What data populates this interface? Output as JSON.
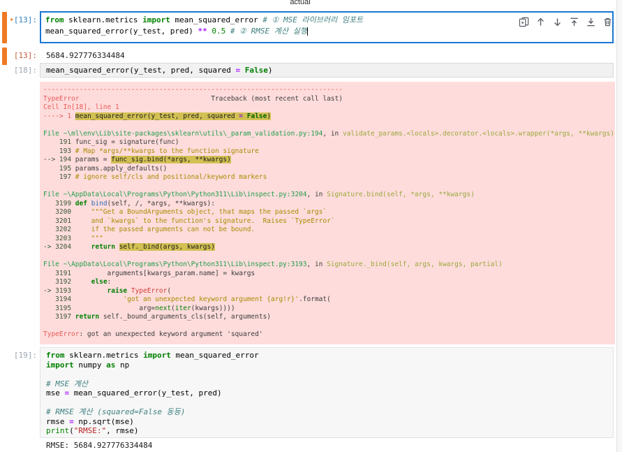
{
  "plot_above": {
    "xaxis_label_clipped": "actual"
  },
  "colors": {
    "active_cell_border": "#1976d2",
    "dirty_cell_bar": "#ee7a24",
    "error_background": "#ffdcdc",
    "error_highlight": "#d2c053",
    "input_prompt_active": "#307fc1",
    "input_prompt_idle": "#9aa5b1",
    "output_prompt": "#bf5b3d"
  },
  "cell_toolbar": {
    "icons": [
      "duplicate-cell-icon",
      "move-cell-up-icon",
      "move-cell-down-icon",
      "insert-cell-above-icon",
      "insert-cell-below-icon",
      "delete-cell-icon"
    ]
  },
  "cells": {
    "c13": {
      "bullet": "•",
      "prompt": "[13]:",
      "code": [
        [
          [
            "k",
            "from"
          ],
          [
            "p",
            " sklearn.metrics "
          ],
          [
            "k",
            "import"
          ],
          [
            "p",
            " mean_squared_error "
          ],
          [
            "c",
            "# ① MSE 라이브러리 임포트"
          ]
        ],
        [
          [
            "p",
            "mean_squared_error(y_test, pred) "
          ],
          [
            "o",
            "**"
          ],
          [
            "p",
            " "
          ],
          [
            "n",
            "0.5"
          ],
          [
            "p",
            " "
          ],
          [
            "c",
            "# ② RMSE 계산 실행"
          ],
          [
            "cur",
            ""
          ]
        ]
      ]
    },
    "o13": {
      "prompt": "[13]:",
      "value": "5684.927776334484"
    },
    "c18": {
      "prompt": "[18]:",
      "code": [
        [
          [
            "p",
            "mean_squared_error(y_test, pred, squared "
          ],
          [
            "o",
            "="
          ],
          [
            "p",
            " "
          ],
          [
            "k",
            "False"
          ],
          [
            "p",
            ")"
          ]
        ]
      ]
    },
    "traceback": {
      "lines": [
        [
          [
            "r",
            "---------------------------------------------------------------------------"
          ]
        ],
        [
          [
            "r",
            "TypeError"
          ],
          [
            "d",
            "                                 Traceback (most recent call last)"
          ]
        ],
        [
          [
            "r",
            "Cell In[18], line 1"
          ]
        ],
        [
          [
            "r",
            "----> 1"
          ],
          [
            "p",
            " "
          ],
          [
            "hl",
            "mean_squared_error(y_test, pred, squared "
          ],
          [
            "hlo",
            "="
          ],
          [
            "hl",
            " "
          ],
          [
            "hlk",
            "False"
          ],
          [
            "hl",
            ")"
          ]
        ],
        [],
        [
          [
            "g",
            "File ~\\ml\\env\\Lib\\site-packages\\sklearn\\utils\\_param_validation.py:194"
          ],
          [
            "d",
            ", in "
          ],
          [
            "fn",
            "validate_params.<locals>.decorator.<locals>.wrapper(*args, **kwargs)"
          ]
        ],
        [
          [
            "ln",
            "    191 "
          ],
          [
            "d",
            "func_sig = signature(func)"
          ]
        ],
        [
          [
            "ln",
            "    193 "
          ],
          [
            "y",
            "# Map *args/**kwargs to the function signature"
          ]
        ],
        [
          [
            "ln",
            "--> 194 "
          ],
          [
            "d",
            "params = "
          ],
          [
            "hl",
            "func_sig.bind(*args, **kwargs)"
          ]
        ],
        [
          [
            "ln",
            "    195 "
          ],
          [
            "d",
            "params.apply_defaults()"
          ]
        ],
        [
          [
            "ln",
            "    197 "
          ],
          [
            "y",
            "# ignore self/cls and positional/keyword markers"
          ]
        ],
        [],
        [
          [
            "g",
            "File ~\\AppData\\Local\\Programs\\Python\\Python311\\Lib\\inspect.py:3204"
          ],
          [
            "d",
            ", in "
          ],
          [
            "fn",
            "Signature.bind(self, *args, **kwargs)"
          ]
        ],
        [
          [
            "ln",
            "   3199 "
          ],
          [
            "k",
            "def "
          ],
          [
            "fn2",
            "bind"
          ],
          [
            "d",
            "(self, /, *args, **kwargs):"
          ]
        ],
        [
          [
            "ln",
            "   3200 "
          ],
          [
            "y",
            "    \"\"\"Get a BoundArguments object, that maps the passed `args`"
          ]
        ],
        [
          [
            "ln",
            "   3201 "
          ],
          [
            "y",
            "    and `kwargs` to the function's signature.  Raises `TypeError`"
          ]
        ],
        [
          [
            "ln",
            "   3202 "
          ],
          [
            "y",
            "    if the passed arguments can not be bound."
          ]
        ],
        [
          [
            "ln",
            "   3203 "
          ],
          [
            "y",
            "    \"\"\""
          ]
        ],
        [
          [
            "ln",
            "-> 3204 "
          ],
          [
            "d",
            "    "
          ],
          [
            "k",
            "return "
          ],
          [
            "hl",
            "self._bind(args, kwargs)"
          ]
        ],
        [],
        [
          [
            "g",
            "File ~\\AppData\\Local\\Programs\\Python\\Python311\\Lib\\inspect.py:3193"
          ],
          [
            "d",
            ", in "
          ],
          [
            "fn",
            "Signature._bind(self, args, kwargs, partial)"
          ]
        ],
        [
          [
            "ln",
            "   3191 "
          ],
          [
            "d",
            "        arguments[kwargs_param.name] = kwargs"
          ]
        ],
        [
          [
            "ln",
            "   3192 "
          ],
          [
            "d",
            "    "
          ],
          [
            "k",
            "else"
          ],
          [
            "d",
            ":"
          ]
        ],
        [
          [
            "ln",
            "-> 3193 "
          ],
          [
            "d",
            "        "
          ],
          [
            "k",
            "raise "
          ],
          [
            "exc",
            "TypeError"
          ],
          [
            "d",
            "("
          ]
        ],
        [
          [
            "ln",
            "   3194 "
          ],
          [
            "y",
            "            'got an unexpected keyword argument {arg!r}'"
          ],
          [
            "d",
            ".format("
          ]
        ],
        [
          [
            "ln",
            "   3195 "
          ],
          [
            "d",
            "                arg="
          ],
          [
            "b2",
            "next"
          ],
          [
            "d",
            "("
          ],
          [
            "b2",
            "iter"
          ],
          [
            "d",
            "(kwargs))))"
          ]
        ],
        [
          [
            "ln",
            "   3197 "
          ],
          [
            "k",
            "return "
          ],
          [
            "d",
            "self._bound_arguments_cls(self, arguments)"
          ]
        ],
        [],
        [
          [
            "r",
            "TypeError"
          ],
          [
            "d",
            ": got an unexpected keyword argument 'squared'"
          ]
        ]
      ]
    },
    "c19": {
      "prompt": "[19]:",
      "code": [
        [
          [
            "k",
            "from"
          ],
          [
            "p",
            " sklearn.metrics "
          ],
          [
            "k",
            "import"
          ],
          [
            "p",
            " mean_squared_error"
          ]
        ],
        [
          [
            "k",
            "import"
          ],
          [
            "p",
            " numpy "
          ],
          [
            "k",
            "as"
          ],
          [
            "p",
            " np"
          ]
        ],
        [],
        [
          [
            "c",
            "# MSE 계산"
          ]
        ],
        [
          [
            "p",
            "mse "
          ],
          [
            "o",
            "="
          ],
          [
            "p",
            " mean_squared_error(y_test, pred)"
          ]
        ],
        [],
        [
          [
            "c",
            "# RMSE 계산 (squared=False 동등)"
          ]
        ],
        [
          [
            "p",
            "rmse "
          ],
          [
            "o",
            "="
          ],
          [
            "p",
            " np.sqrt(mse)"
          ]
        ],
        [
          [
            "b2",
            "print"
          ],
          [
            "p",
            "("
          ],
          [
            "s",
            "\"RMSE:\""
          ],
          [
            "p",
            ", rmse)"
          ]
        ]
      ]
    },
    "o19": {
      "text": "RMSE: 5684.927776334484"
    }
  }
}
